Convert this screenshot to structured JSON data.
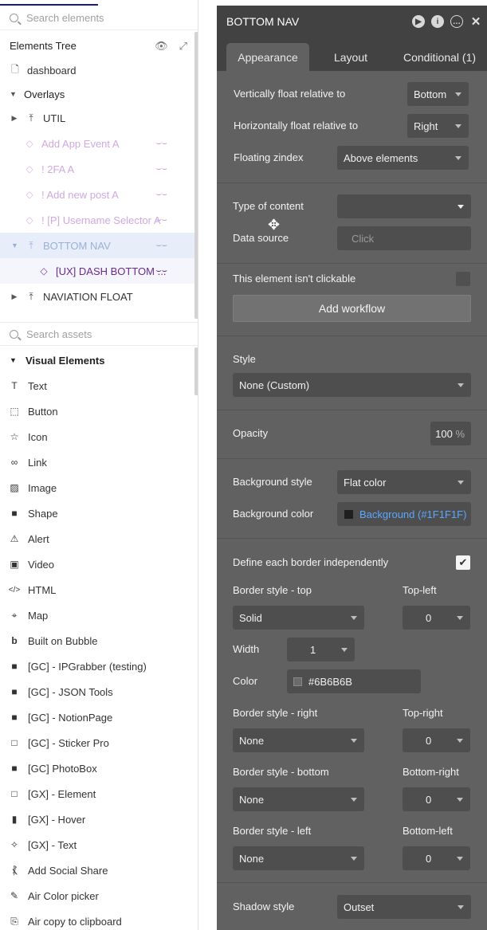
{
  "left": {
    "search_elements_placeholder": "Search elements",
    "tree_title": "Elements Tree",
    "tree": [
      {
        "label": "dashboard",
        "icon": "page-icon"
      },
      {
        "label": "Overlays",
        "icon": "caret-down"
      },
      {
        "label": "UTIL",
        "icon": "float-group-icon"
      },
      {
        "label": "Add App Event A",
        "icon": "popup-icon"
      },
      {
        "label": "! 2FA A",
        "icon": "popup-icon"
      },
      {
        "label": "! Add new post A",
        "icon": "popup-icon"
      },
      {
        "label": "! [P] Username Selector A",
        "icon": "popup-icon"
      },
      {
        "label": "BOTTOM NAV",
        "icon": "float-group-icon"
      },
      {
        "label": "[UX] DASH BOTTOM ...",
        "icon": "reusable-icon"
      },
      {
        "label": "NAVIATION FLOAT",
        "icon": "float-group-icon"
      }
    ],
    "search_assets_placeholder": "Search assets",
    "assets_title": "Visual Elements",
    "assets": [
      {
        "label": "Text",
        "icon": "text-icon"
      },
      {
        "label": "Button",
        "icon": "button-icon"
      },
      {
        "label": "Icon",
        "icon": "star-icon"
      },
      {
        "label": "Link",
        "icon": "link-icon"
      },
      {
        "label": "Image",
        "icon": "image-icon"
      },
      {
        "label": "Shape",
        "icon": "shape-icon"
      },
      {
        "label": "Alert",
        "icon": "alert-icon"
      },
      {
        "label": "Video",
        "icon": "video-icon"
      },
      {
        "label": "HTML",
        "icon": "html-icon"
      },
      {
        "label": "Map",
        "icon": "map-pin-icon"
      },
      {
        "label": "Built on Bubble",
        "icon": "bubble-icon"
      },
      {
        "label": "[GC] - IPGrabber (testing)",
        "icon": "plugin-icon"
      },
      {
        "label": "[GC] - JSON Tools",
        "icon": "plugin-icon"
      },
      {
        "label": "[GC] - NotionPage",
        "icon": "plugin-icon"
      },
      {
        "label": "[GC] - Sticker Pro",
        "icon": "plugin-outline-icon"
      },
      {
        "label": "[GC] PhotoBox",
        "icon": "plugin-icon"
      },
      {
        "label": "[GX] - Element",
        "icon": "plugin-outline-icon"
      },
      {
        "label": "[GX] - Hover",
        "icon": "mouse-icon"
      },
      {
        "label": "[GX] - Text",
        "icon": "wand-icon"
      },
      {
        "label": "Add Social Share",
        "icon": "share-icon"
      },
      {
        "label": "Air Color picker",
        "icon": "dropper-icon"
      },
      {
        "label": "Air copy to clipboard",
        "icon": "clipboard-icon"
      }
    ]
  },
  "panel": {
    "title": "BOTTOM NAV",
    "tabs": [
      "Appearance",
      "Layout",
      "Conditional (1)"
    ],
    "vfloat_label": "Vertically float relative to",
    "vfloat_value": "Bottom",
    "hfloat_label": "Horizontally float relative to",
    "hfloat_value": "Right",
    "zindex_label": "Floating zindex",
    "zindex_value": "Above elements",
    "content_type_label": "Type of content",
    "content_type_value": "",
    "data_source_label": "Data source",
    "data_source_placeholder": "Click",
    "not_clickable_label": "This element isn't clickable",
    "add_workflow": "Add workflow",
    "style_label": "Style",
    "style_value": "None (Custom)",
    "opacity_label": "Opacity",
    "opacity_value": "100",
    "opacity_unit": "%",
    "bg_style_label": "Background style",
    "bg_style_value": "Flat color",
    "bg_color_label": "Background color",
    "bg_color_value": "Background (#1F1F1F)",
    "bg_color_hex": "#1F1F1F",
    "border_indep_label": "Define each border independently",
    "border_top_label": "Border style - top",
    "border_top_value": "Solid",
    "top_left_label": "Top-left",
    "top_left_value": "0",
    "width_label": "Width",
    "width_value": "1",
    "color_label": "Color",
    "color_value": "#6B6B6B",
    "border_right_label": "Border style - right",
    "border_right_value": "None",
    "top_right_label": "Top-right",
    "top_right_value": "0",
    "border_bottom_label": "Border style - bottom",
    "border_bottom_value": "None",
    "bottom_right_label": "Bottom-right",
    "bottom_right_value": "0",
    "border_left_label": "Border style - left",
    "border_left_value": "None",
    "bottom_left_label": "Bottom-left",
    "bottom_left_value": "0",
    "shadow_label": "Shadow style",
    "shadow_value": "Outset"
  },
  "colors": {
    "panel_bg": "#616161",
    "panel_header": "#424242",
    "accent_link": "#5aa7ff",
    "selected_row": "#e8eef9",
    "purple": "#6b2a8a"
  }
}
